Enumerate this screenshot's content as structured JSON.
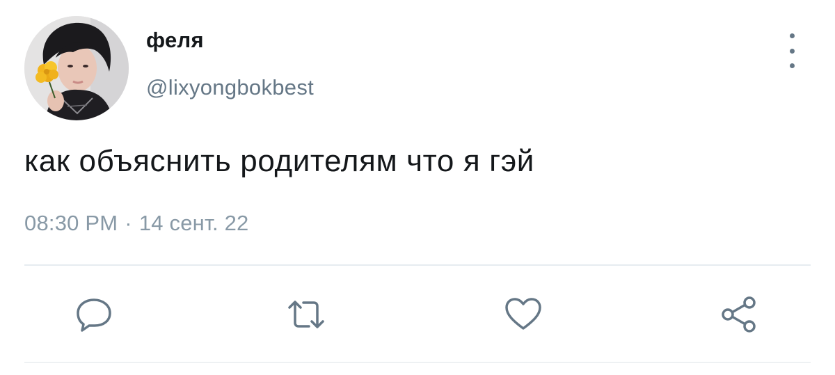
{
  "tweet": {
    "display_name": "феля",
    "handle": "@lixyongbokbest",
    "text": "как объяснить родителям что я гэй",
    "time": "08:30 PM",
    "separator": "·",
    "date": "14 сент. 22"
  },
  "actions": {
    "reply": "reply-icon",
    "retweet": "retweet-icon",
    "like": "heart-icon",
    "share": "share-icon",
    "more": "more-vertical-icon"
  },
  "colors": {
    "text_primary": "#14171a",
    "text_secondary": "#657786",
    "timestamp": "#8899a6",
    "icon": "#657786",
    "divider": "#e6ecf0"
  }
}
